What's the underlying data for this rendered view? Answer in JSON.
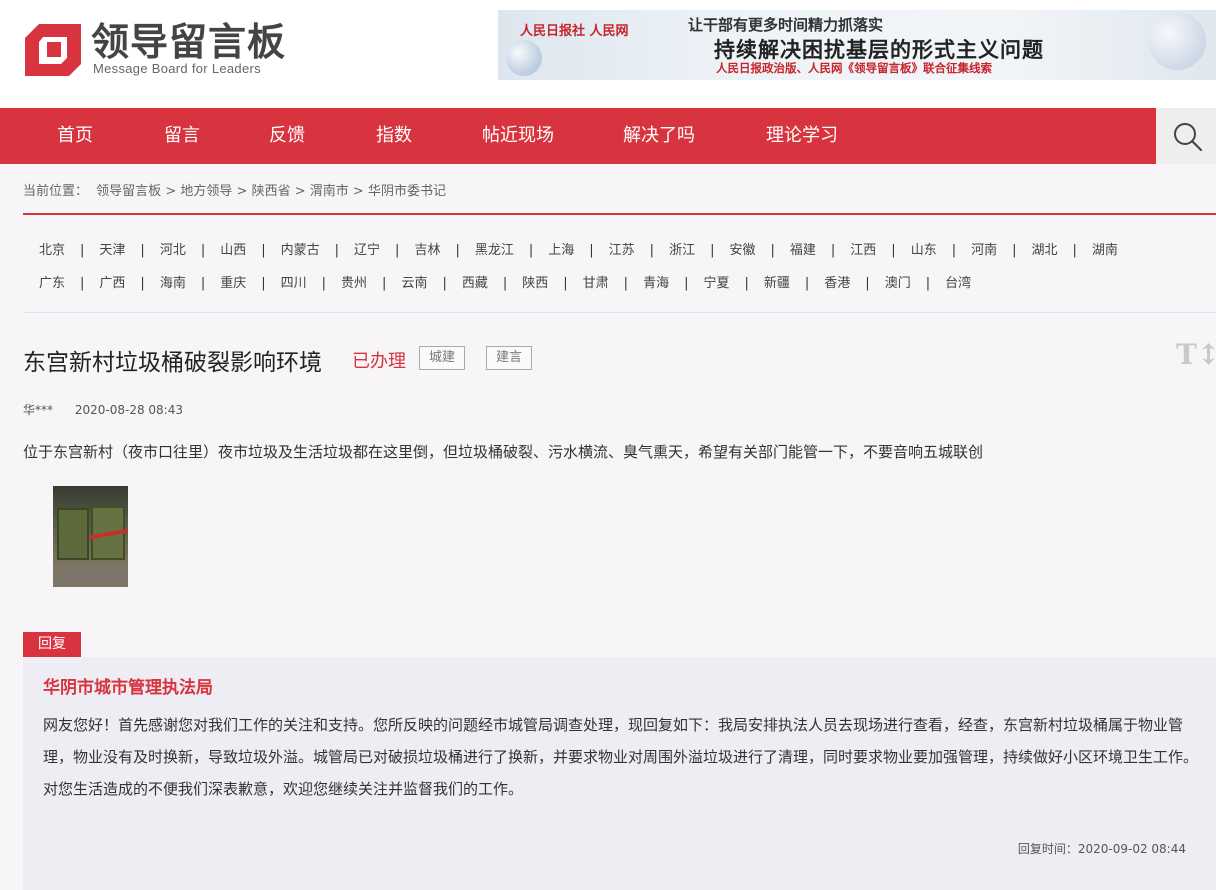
{
  "header": {
    "logo_title": "领导留言板",
    "logo_subtitle": "Message Board for Leaders",
    "brand_color": "#d8343f"
  },
  "banner": {
    "logos": "人民日报社  人民网",
    "line1": "让干部有更多时间精力抓落实",
    "line2": "持续解决困扰基层的形式主义问题",
    "line3": "人民日报政治版、人民网《领导留言板》联合征集线索"
  },
  "nav": {
    "items": [
      "首页",
      "留言",
      "反馈",
      "指数",
      "帖近现场",
      "解决了吗",
      "理论学习"
    ],
    "search_icon": "search-icon"
  },
  "breadcrumb": {
    "label": "当前位置：",
    "items": [
      "领导留言板",
      "地方领导",
      "陕西省",
      "渭南市",
      "华阴市委书记"
    ],
    "separator": ">"
  },
  "provinces": {
    "row1": [
      "北京",
      "天津",
      "河北",
      "山西",
      "内蒙古",
      "辽宁",
      "吉林",
      "黑龙江",
      "上海",
      "江苏",
      "浙江",
      "安徽",
      "福建",
      "江西",
      "山东",
      "河南",
      "湖北",
      "湖南"
    ],
    "row2": [
      "广东",
      "广西",
      "海南",
      "重庆",
      "四川",
      "贵州",
      "云南",
      "西藏",
      "陕西",
      "甘肃",
      "青海",
      "宁夏",
      "新疆",
      "香港",
      "澳门",
      "台湾"
    ],
    "separator": "|"
  },
  "post": {
    "title": "东宫新村垃圾桶破裂影响环境",
    "status": "已办理",
    "tags": [
      "城建",
      "建言"
    ],
    "font_toggle": "T↕",
    "author": "华***",
    "date": "2020-08-28 08:43",
    "content": "位于东宫新村（夜市口往里）夜市垃圾及生活垃圾都在这里倒，但垃圾桶破裂、污水横流、臭气熏天，希望有关部门能管一下，不要音响五城联创"
  },
  "reply": {
    "tab_label": "回复",
    "org": "华阴市城市管理执法局",
    "paragraph1": "网友您好！首先感谢您对我们工作的关注和支持。您所反映的问题经市城管局调查处理，现回复如下：我局安排执法人员去现场进行查看，经查，东宫新村垃圾桶属于物业管理，物业没有及时换新，导致垃圾外溢。城管局已对破损垃圾桶进行了换新，并要求物业对周围外溢垃圾进行了清理，同时要求物业要加强管理，持续做好小区环境卫生工作。",
    "paragraph2": "对您生活造成的不便我们深表歉意，欢迎您继续关注并监督我们的工作。",
    "time_label": "回复时间：",
    "time": "2020-09-02 08:44"
  }
}
